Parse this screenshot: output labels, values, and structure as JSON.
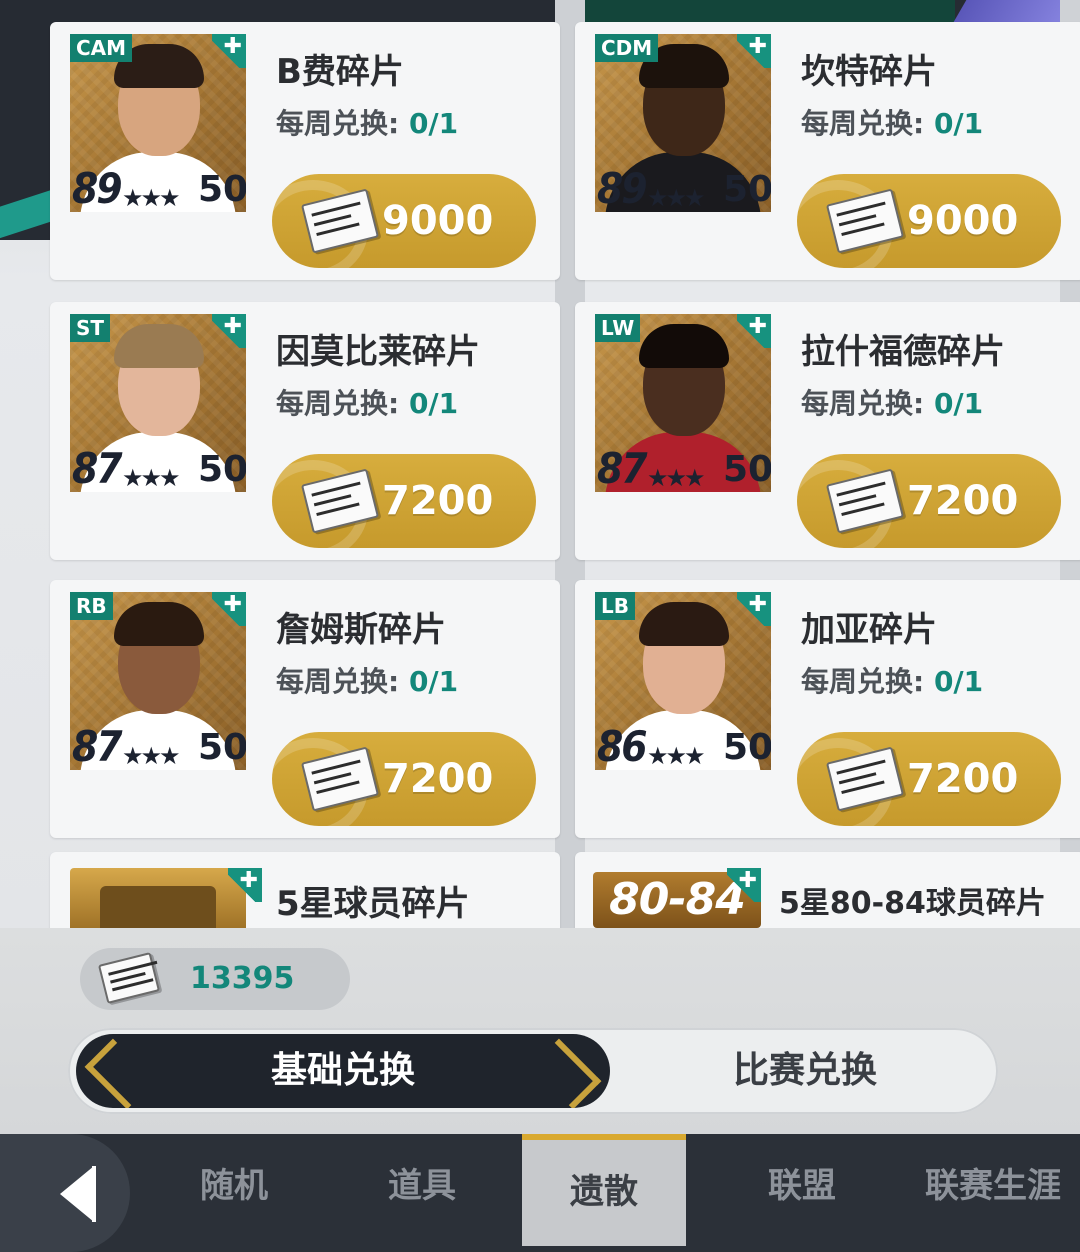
{
  "cards": [
    {
      "position": "CAM",
      "rating": "89",
      "stars": "★★★",
      "level": "50",
      "name": "B费碎片",
      "weekly_label": "每周兑换:",
      "weekly_count": "0/1",
      "price": "9000",
      "skin": "#d7a57f",
      "hair": "#2b1d16",
      "shirt": "#ffffff"
    },
    {
      "position": "CDM",
      "rating": "89",
      "stars": "★★★",
      "level": "50",
      "name": "坎特碎片",
      "weekly_label": "每周兑换:",
      "weekly_count": "0/1",
      "price": "9000",
      "skin": "#3e2718",
      "hair": "#1c120c",
      "shirt": "#1a1a1e"
    },
    {
      "position": "ST",
      "rating": "87",
      "stars": "★★★",
      "level": "50",
      "name": "因莫比莱碎片",
      "weekly_label": "每周兑换:",
      "weekly_count": "0/1",
      "price": "7200",
      "skin": "#e3b69b",
      "hair": "#9a7b52",
      "shirt": "#ffffff"
    },
    {
      "position": "LW",
      "rating": "87",
      "stars": "★★★",
      "level": "50",
      "name": "拉什福德碎片",
      "weekly_label": "每周兑换:",
      "weekly_count": "0/1",
      "price": "7200",
      "skin": "#4a2e1f",
      "hair": "#120b08",
      "shirt": "#b0202c"
    },
    {
      "position": "RB",
      "rating": "87",
      "stars": "★★★",
      "level": "50",
      "name": "詹姆斯碎片",
      "weekly_label": "每周兑换:",
      "weekly_count": "0/1",
      "price": "7200",
      "skin": "#8a5a3c",
      "hair": "#2a1a10",
      "shirt": "#ffffff"
    },
    {
      "position": "LB",
      "rating": "86",
      "stars": "★★★",
      "level": "50",
      "name": "加亚碎片",
      "weekly_label": "每周兑换:",
      "weekly_count": "0/1",
      "price": "7200",
      "skin": "#e1b093",
      "hair": "#2a1a12",
      "shirt": "#ffffff"
    }
  ],
  "partial_cards": [
    {
      "name": "5星球员碎片"
    },
    {
      "name": "5星80-84球员碎片",
      "range_label": "80-84"
    }
  ],
  "currency": {
    "amount": "13395"
  },
  "exchange_switch": {
    "active": "基础兑换",
    "inactive": "比赛兑换"
  },
  "tabs": [
    "随机",
    "道具",
    "遗散",
    "联盟",
    "联赛生涯"
  ],
  "active_tab": "遗散",
  "colors": {
    "accent_teal": "#13877a",
    "gold": "#c69a2c",
    "dark": "#1f242c"
  }
}
